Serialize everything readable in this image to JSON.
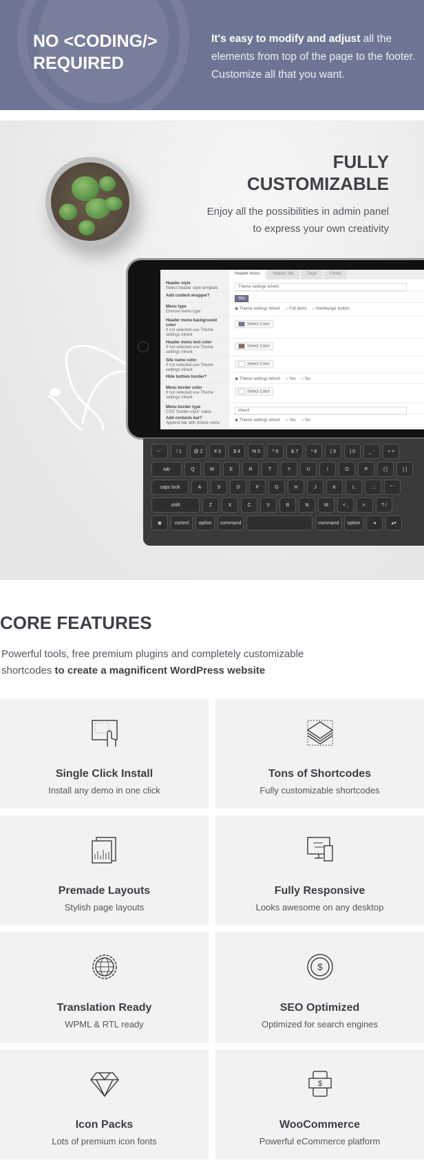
{
  "banner": {
    "title_line1": "NO <CODING/>",
    "title_line2": "REQUIRED",
    "text_bold": "It's easy to modify and adjust",
    "text_rest": " all the elements from top of the page to the footer. Customize all that you want.",
    "bg_color": "#6e7594"
  },
  "customizable": {
    "title_line1": "FULLY",
    "title_line2": "CUSTOMIZABLE",
    "sub_line1": "Enjoy all the possibilities in admin panel",
    "sub_line2": "to express your own creativity"
  },
  "admin": {
    "tabs": [
      "Header menu",
      "Header title",
      "Page",
      "Footer"
    ],
    "rows": [
      {
        "label": "Header style",
        "desc": "Select header style template",
        "control": "input",
        "value": "Theme settings inherit"
      },
      {
        "label": "Add content wrapper?",
        "desc": "",
        "control": "switch",
        "value": "Yes"
      },
      {
        "label": "Menu type",
        "desc": "Choose menu type",
        "control": "radio",
        "options": [
          "Theme settings inherit",
          "Full items",
          "Hamburger button"
        ]
      },
      {
        "label": "Header menu background color",
        "desc": "If not selected use Theme settings inherit",
        "control": "color",
        "value": "Select Color",
        "swatch": "#6e7594"
      },
      {
        "label": "Header menu text color",
        "desc": "If not selected use Theme settings inherit",
        "control": "color",
        "value": "Select Color",
        "swatch": "#8a6e5e"
      },
      {
        "label": "Site name color",
        "desc": "If not selected use Theme settings inherit",
        "control": "color",
        "value": "Select Color",
        "swatch": "#ffffff"
      },
      {
        "label": "Hide bottom border?",
        "desc": "",
        "control": "radio",
        "options": [
          "Theme settings inherit",
          "Yes",
          "No"
        ]
      },
      {
        "label": "Menu border color",
        "desc": "If not selected use Theme settings inherit",
        "control": "color",
        "value": "Select Color",
        "swatch": "#ffffff"
      },
      {
        "label": "Menu border type",
        "desc": "CSS \"border-style\" value",
        "control": "input",
        "value": "inherit"
      },
      {
        "label": "Add contacts bar?",
        "desc": "Append bar with phone nums",
        "control": "radio",
        "options": [
          "Theme settings inherit",
          "Yes",
          "No"
        ]
      }
    ]
  },
  "keyboard": {
    "rows": [
      [
        "~ `",
        "! 1",
        "@ 2",
        "# 3",
        "$ 4",
        "% 5",
        "^ 6",
        "& 7",
        "* 8",
        "( 9",
        ") 0",
        "_ -",
        "+ ="
      ],
      [
        "tab",
        "Q",
        "W",
        "E",
        "R",
        "T",
        "Y",
        "U",
        "I",
        "O",
        "P",
        "{ [",
        "} ]"
      ],
      [
        "caps lock",
        "A",
        "S",
        "D",
        "F",
        "G",
        "H",
        "J",
        "K",
        "L",
        ": ;",
        "\" '"
      ],
      [
        "shift",
        "Z",
        "X",
        "C",
        "V",
        "B",
        "N",
        "M",
        "< ,",
        "> .",
        "? /"
      ],
      [
        "◉",
        "control",
        "option",
        "command",
        " ",
        "command",
        "option",
        "◂",
        "▴▾"
      ]
    ]
  },
  "core": {
    "title": "CORE FEATURES",
    "sub_plain": "Powerful tools, free premium plugins and completely customizable shortcodes ",
    "sub_bold": "to create a magnificent WordPress website"
  },
  "features": [
    {
      "icon": "touch-screen-icon",
      "title": "Single Click Install",
      "desc": "Install any demo in one click"
    },
    {
      "icon": "layers-icon",
      "title": "Tons of Shortcodes",
      "desc": "Fully customizable shortcodes"
    },
    {
      "icon": "layout-pages-icon",
      "title": "Premade Layouts",
      "desc": "Stylish page layouts"
    },
    {
      "icon": "devices-icon",
      "title": "Fully Responsive",
      "desc": "Looks awesome on any desktop"
    },
    {
      "icon": "globe-gear-icon",
      "title": "Translation Ready",
      "desc": "WPML & RTL ready"
    },
    {
      "icon": "seo-coin-icon",
      "title": "SEO Optimized",
      "desc": "Optimized for search engines"
    },
    {
      "icon": "diamond-icon",
      "title": "Icon Packs",
      "desc": "Lots of premium icon fonts"
    },
    {
      "icon": "mobile-payment-icon",
      "title": "WooCommerce",
      "desc": "Powerful eCommerce platform"
    }
  ]
}
